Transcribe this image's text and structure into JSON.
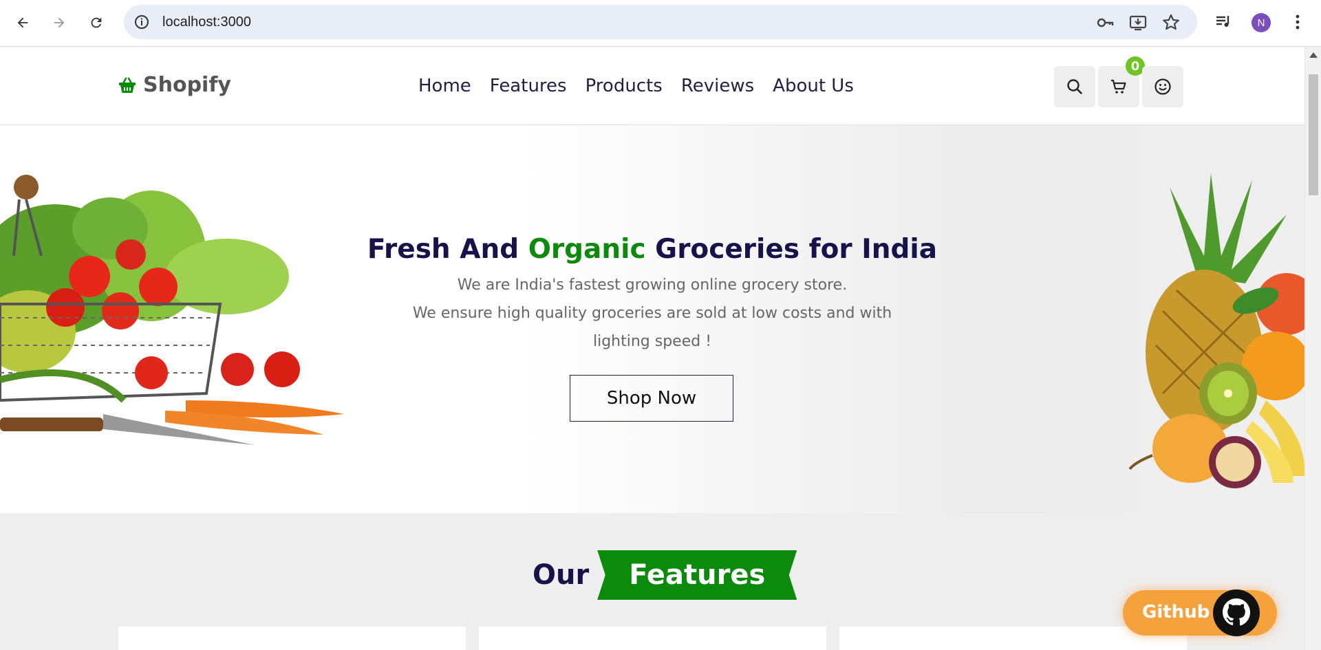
{
  "browser": {
    "url": "localhost:3000",
    "profile_initial": "N",
    "icons": {
      "back": "back-arrow-icon",
      "forward": "forward-arrow-icon",
      "reload": "reload-icon",
      "site_info": "info-icon",
      "password": "key-icon",
      "install": "install-app-icon",
      "bookmark": "star-icon",
      "media": "media-control-icon",
      "menu": "kebab-menu-icon"
    },
    "colors": {
      "omnibox": "#e9edf8",
      "profile": "#7c4dbe"
    }
  },
  "site": {
    "logo_text": "Shopify",
    "nav": [
      "Home",
      "Features",
      "Products",
      "Reviews",
      "About Us"
    ],
    "cart_count": "0",
    "icons": {
      "logo": "basket-icon",
      "search": "search-icon",
      "cart": "cart-icon",
      "account": "smiley-icon"
    },
    "colors": {
      "accent_green": "#0b8a0b",
      "navy": "#16124a",
      "badge": "#6fc323"
    }
  },
  "hero": {
    "title_part1": "Fresh And ",
    "title_highlight": "Organic",
    "title_part2": " Groceries for India",
    "subtitle_line1": "We are India's fastest growing online grocery store.",
    "subtitle_line2": "We ensure high quality groceries are sold at low costs and with lighting speed !",
    "cta": "Shop Now",
    "images": [
      "vegetable-basket-image",
      "fruit-pile-image"
    ]
  },
  "features": {
    "heading_prefix": "Our",
    "heading_ribbon": "Features"
  },
  "github_button": {
    "label": "Github",
    "icon": "github-icon",
    "color": "#f6a23c"
  }
}
